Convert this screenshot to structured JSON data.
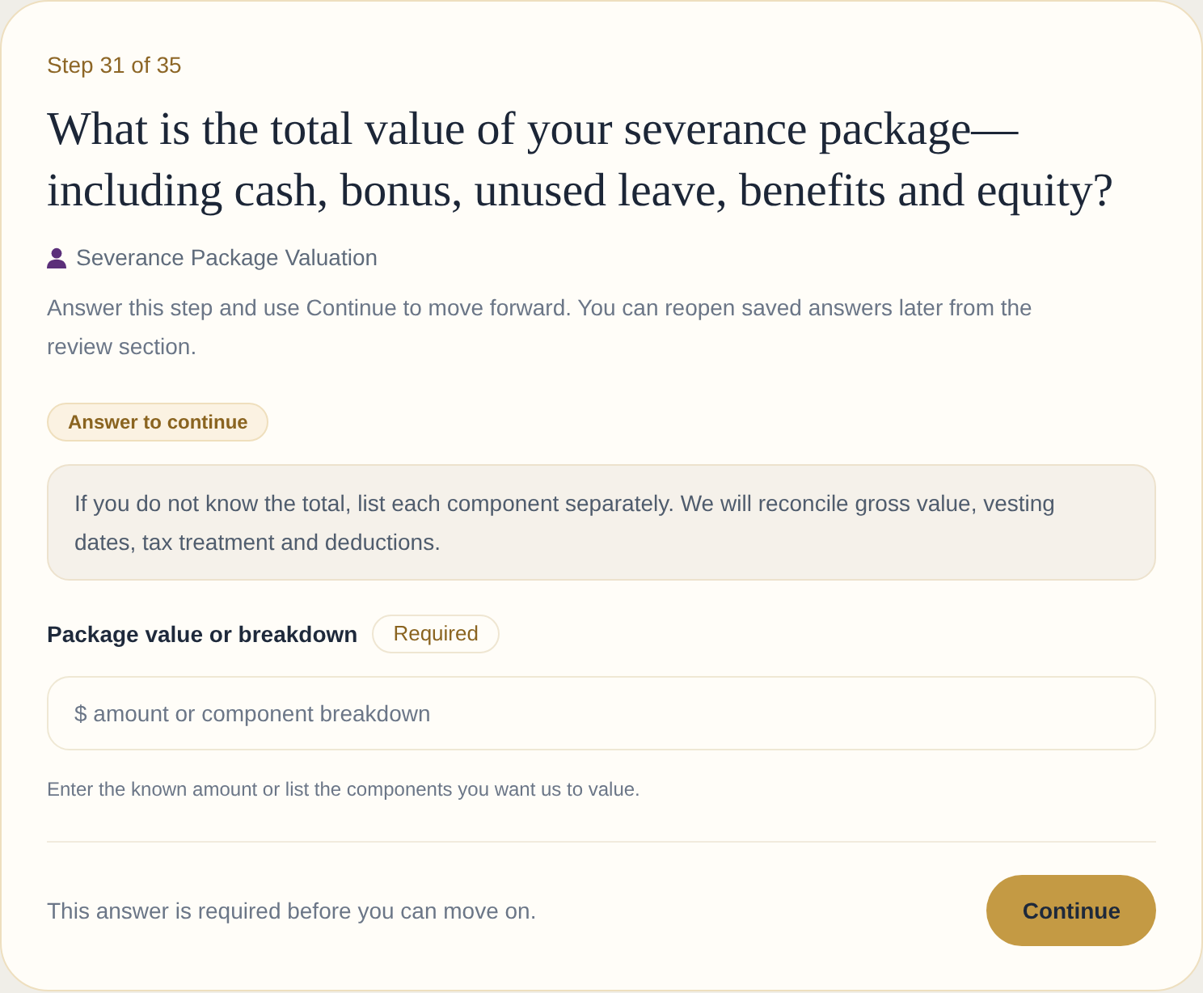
{
  "step": "Step 31 of 35",
  "question": "What is the total value of your severance package—including cash, bonus, unused leave, benefits and equity?",
  "section": {
    "label": "Severance Package Valuation"
  },
  "description": "Answer this step and use Continue to move forward. You can reopen saved answers later from the review section.",
  "status_badge": "Answer to continue",
  "info": "If you do not know the total, list each component separately. We will reconcile gross value, vesting dates, tax treatment and deductions.",
  "field": {
    "label": "Package value or breakdown",
    "required_badge": "Required",
    "placeholder": "$ amount or component breakdown",
    "hint": "Enter the known amount or list the components you want us to value."
  },
  "footer": {
    "message": "This answer is required before you can move on.",
    "button": "Continue"
  }
}
